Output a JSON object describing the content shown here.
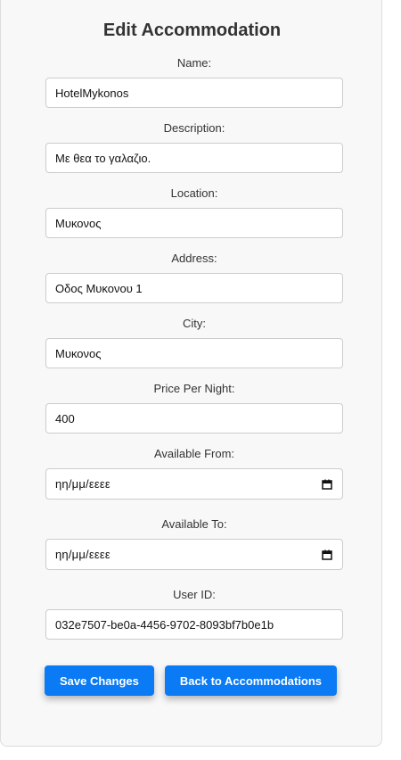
{
  "page": {
    "title": "Edit Accommodation"
  },
  "form": {
    "name": {
      "label": "Name:",
      "value": "HotelMykonos"
    },
    "description": {
      "label": "Description:",
      "value": "Με θεα το γαλαζιο."
    },
    "location": {
      "label": "Location:",
      "value": "Μυκονος"
    },
    "address": {
      "label": "Address:",
      "value": "Οδος Μυκονου 1"
    },
    "city": {
      "label": "City:",
      "value": "Μυκονος"
    },
    "price_per_night": {
      "label": "Price Per Night:",
      "value": "400"
    },
    "available_from": {
      "label": "Available From:",
      "placeholder": "ηη/μμ/εεεε"
    },
    "available_to": {
      "label": "Available To:",
      "placeholder": "ηη/μμ/εεεε"
    },
    "user_id": {
      "label": "User ID:",
      "value": "032e7507-be0a-4456-9702-8093bf7b0e1b"
    }
  },
  "actions": {
    "save_label": "Save Changes",
    "back_label": "Back to Accommodations"
  },
  "colors": {
    "primary_button": "#0a7af5",
    "card_background": "#f8f8f8"
  },
  "icons": {
    "date_picker": "calendar-icon"
  }
}
